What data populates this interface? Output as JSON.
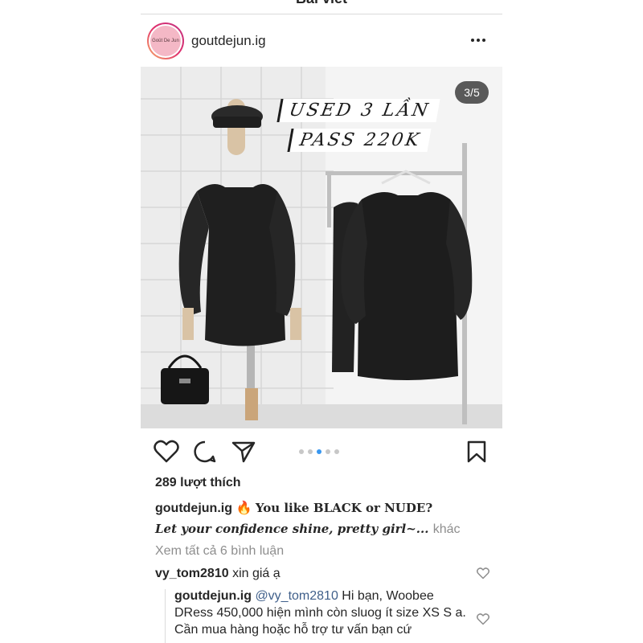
{
  "header": {
    "title": "Bài viết"
  },
  "post": {
    "avatar_text": "Goût De Jun",
    "username": "goutdejun.ig",
    "counter": "3/5",
    "overlay_line1": "USED 3 LẦN",
    "overlay_line2": "PASS 220K",
    "likes": "289 lượt thích",
    "caption_user": "goutdejun.ig",
    "caption_emoji": "🔥",
    "caption_text": "You like BLACK or NUDE?",
    "caption_line2": "Let your confidence shine, pretty girl~...",
    "caption_more": "khác",
    "view_comments": "Xem tất cả 6 bình luận"
  },
  "comments": [
    {
      "user": "vy_tom2810",
      "text": "xin giá ạ"
    }
  ],
  "reply": {
    "user": "goutdejun.ig",
    "mention": "@vy_tom2810",
    "text": "Hi bạn, Woobee DRess 450,000 hiện mình còn sluog ít size XS S a. Cần mua hàng hoặc hỗ trợ tư vấn bạn cứ"
  },
  "carousel": {
    "total": 5,
    "active_index": 2
  },
  "colors": {
    "accent_blue": "#3897f0",
    "muted": "#8e8e8e",
    "mention": "#3f5f8a"
  },
  "icons": [
    "more-icon",
    "heart-icon",
    "comment-icon",
    "share-icon",
    "bookmark-icon",
    "heart-small-icon"
  ]
}
